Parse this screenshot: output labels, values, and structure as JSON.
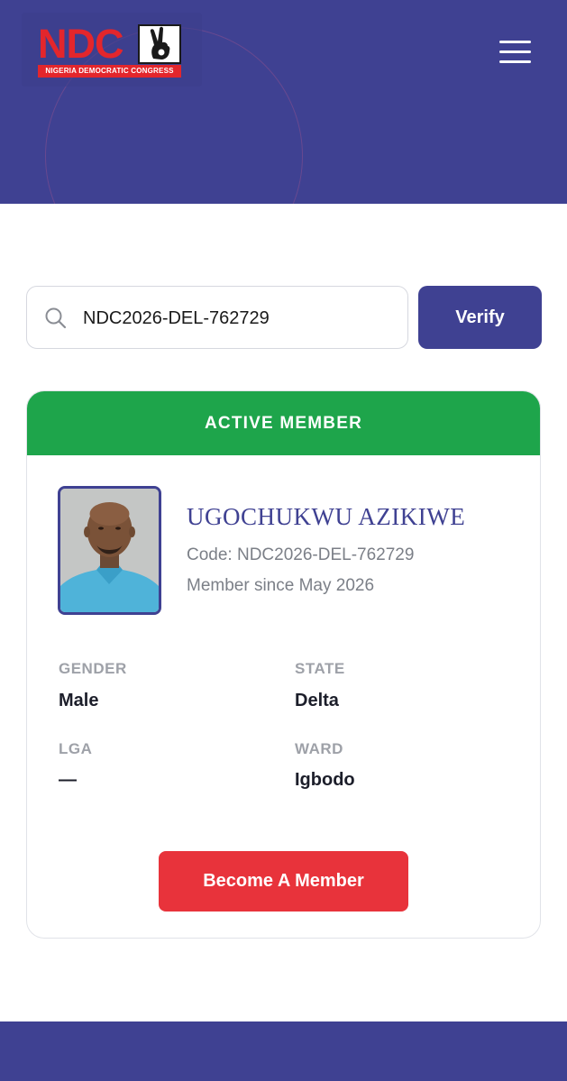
{
  "header": {
    "logo": {
      "wordmark": "NDC",
      "tagline": "NIGERIA DEMOCRATIC CONGRESS"
    },
    "menu_icon": "hamburger-menu-icon"
  },
  "search": {
    "value": "NDC2026-DEL-762729",
    "icon": "search-icon",
    "verify_label": "Verify"
  },
  "card": {
    "status": "ACTIVE MEMBER",
    "name": "UGOCHUKWU AZIKIWE",
    "code": "Code: NDC2026-DEL-762729",
    "member_since": "Member since May 2026",
    "fields": {
      "gender": {
        "label": "GENDER",
        "value": "Male"
      },
      "state": {
        "label": "STATE",
        "value": "Delta"
      },
      "lga": {
        "label": "LGA",
        "value": "—"
      },
      "ward": {
        "label": "WARD",
        "value": "Igbodo"
      }
    },
    "become_member_label": "Become A Member"
  },
  "colors": {
    "brand_blue": "#3f4192",
    "active_green": "#1ea54b",
    "cta_red": "#e8333b",
    "logo_red": "#e3262c"
  }
}
